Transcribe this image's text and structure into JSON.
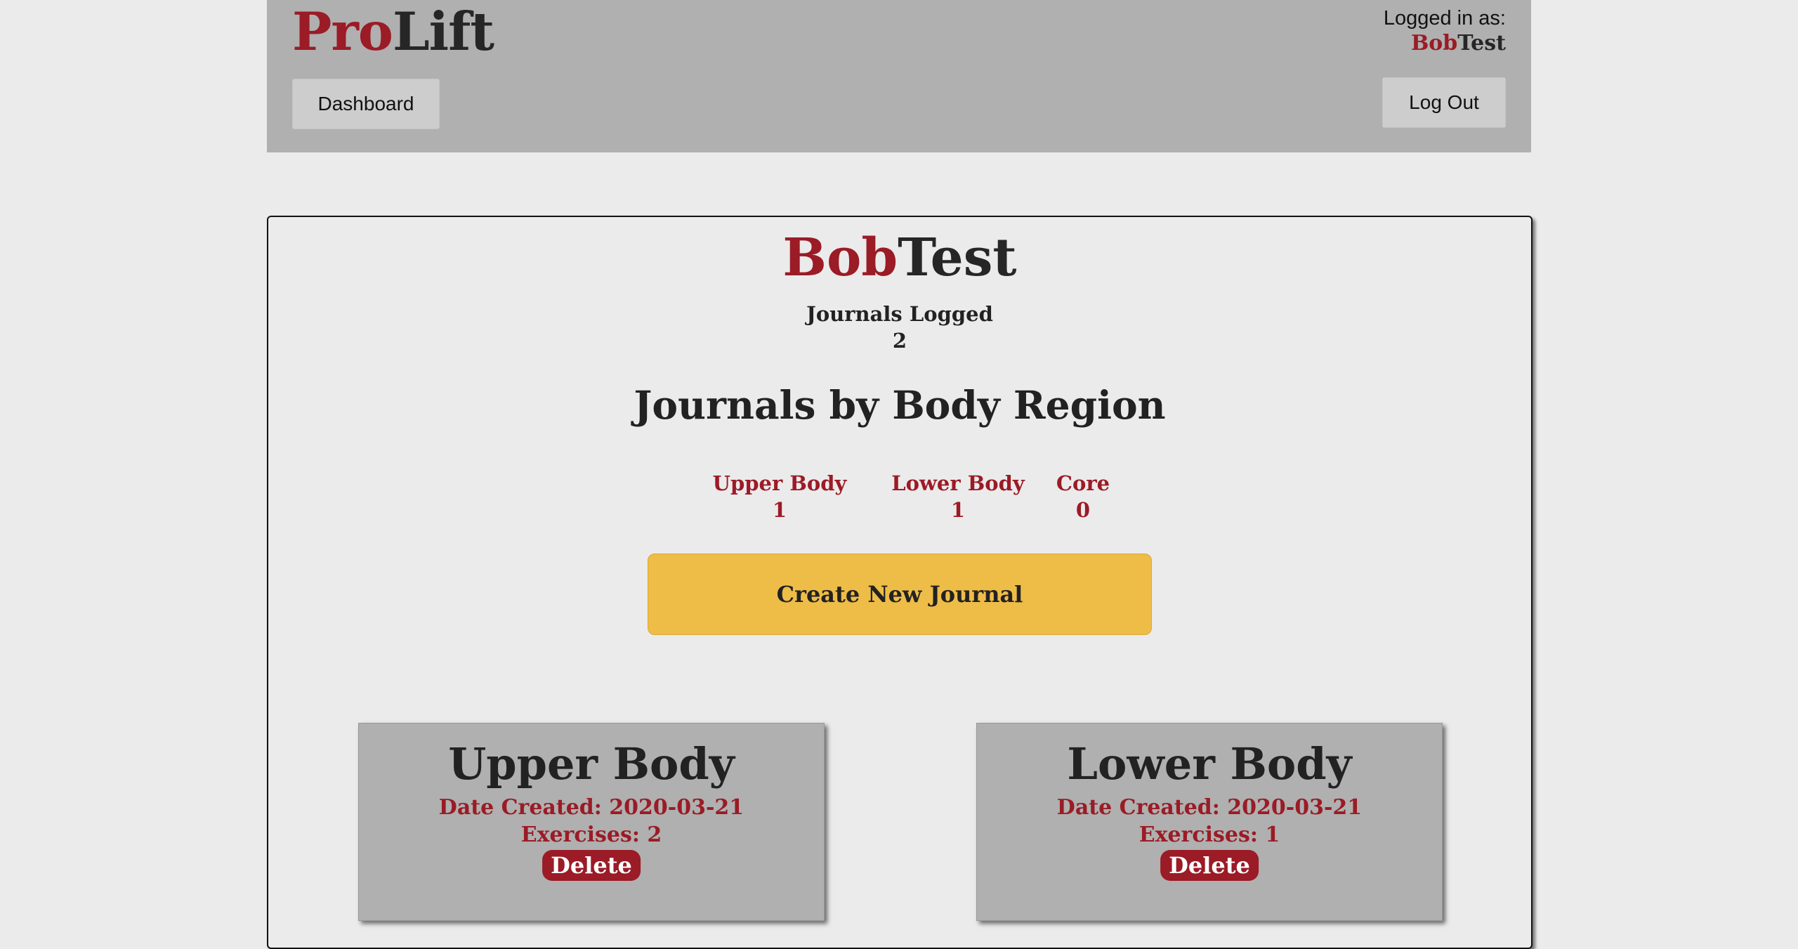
{
  "header": {
    "logo_part1": "Pro",
    "logo_part2": "Lift",
    "dashboard_label": "Dashboard",
    "login_label": "Logged in as:",
    "user_part1": "Bob",
    "user_part2": "Test",
    "logout_label": "Log Out"
  },
  "profile": {
    "name_part1": "Bob",
    "name_part2": "Test",
    "journals_label": "Journals Logged",
    "journals_count": "2"
  },
  "regions": {
    "title": "Journals by Body Region",
    "items": [
      {
        "label": "Upper Body",
        "value": "1"
      },
      {
        "label": "Lower Body",
        "value": "1"
      },
      {
        "label": "Core",
        "value": "0"
      }
    ]
  },
  "create_button_label": "Create New Journal",
  "journals": [
    {
      "title": "Upper Body",
      "date": "Date Created: 2020-03-21",
      "exercises": "Exercises: 2",
      "delete_label": "Delete"
    },
    {
      "title": "Lower Body",
      "date": "Date Created: 2020-03-21",
      "exercises": "Exercises: 1",
      "delete_label": "Delete"
    }
  ],
  "colors": {
    "brand_red": "#9b1b26",
    "accent_yellow": "#eebd47",
    "header_gray": "#afb0af",
    "background": "#ebebeb"
  }
}
